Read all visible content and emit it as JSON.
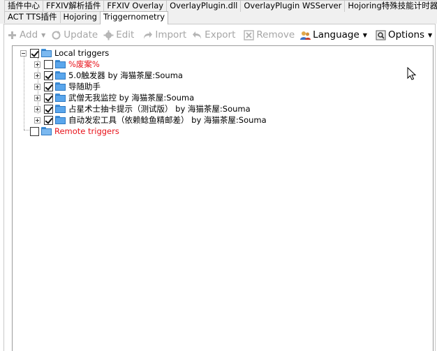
{
  "tabs": {
    "row1": [
      "插件中心",
      "FFXIV解析插件",
      "FFXIV Overlay",
      "OverlayPlugin.dll",
      "OverlayPlugin WSServer",
      "Hojoring特殊技能计时器"
    ],
    "row2": [
      "ACT TTS插件",
      "Hojoring",
      "Triggernometry"
    ],
    "active": "Triggernometry"
  },
  "toolbar": {
    "add": "Add",
    "update": "Update",
    "edit": "Edit",
    "import": "Import",
    "export": "Export",
    "remove": "Remove",
    "language": "Language",
    "options": "Options"
  },
  "tree": {
    "local": {
      "label": "Local triggers",
      "checked": true
    },
    "items": [
      {
        "label": "%废案%",
        "checked": false,
        "red": true
      },
      {
        "label": "5.0触发器 by 海猫茶屋:Souma",
        "checked": true,
        "red": false
      },
      {
        "label": "导随助手",
        "checked": true,
        "red": false
      },
      {
        "label": "武僧无我监控 by 海猫茶屋:Souma",
        "checked": true,
        "red": false
      },
      {
        "label": "占星术士抽卡提示（测试版） by 海猫茶屋:Souma",
        "checked": true,
        "red": false
      },
      {
        "label": "自动发宏工具（依赖鲶鱼精邮差） by 海猫茶屋:Souma",
        "checked": true,
        "red": false
      }
    ],
    "remote": {
      "label": "Remote triggers",
      "checked": false
    }
  },
  "colors": {
    "red_text": "#e8131b",
    "folder_blue": "#5aa6ec",
    "tab_bg": "#f0f0f0"
  }
}
